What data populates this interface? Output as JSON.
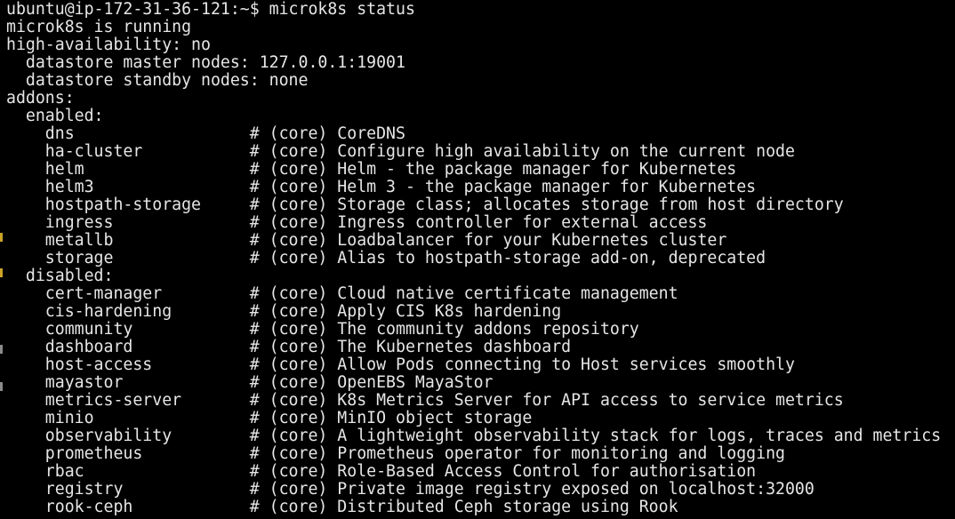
{
  "terminal": {
    "lines": [
      "ubuntu@ip-172-31-36-121:~$ microk8s status",
      "microk8s is running",
      "high-availability: no",
      "  datastore master nodes: 127.0.0.1:19001",
      "  datastore standby nodes: none",
      "addons:",
      "  enabled:",
      "    dns                  # (core) CoreDNS",
      "    ha-cluster           # (core) Configure high availability on the current node",
      "    helm                 # (core) Helm - the package manager for Kubernetes",
      "    helm3                # (core) Helm 3 - the package manager for Kubernetes",
      "    hostpath-storage     # (core) Storage class; allocates storage from host directory",
      "    ingress              # (core) Ingress controller for external access",
      "    metallb              # (core) Loadbalancer for your Kubernetes cluster",
      "    storage              # (core) Alias to hostpath-storage add-on, deprecated",
      "  disabled:",
      "    cert-manager         # (core) Cloud native certificate management",
      "    cis-hardening        # (core) Apply CIS K8s hardening",
      "    community            # (core) The community addons repository",
      "    dashboard            # (core) The Kubernetes dashboard",
      "    host-access          # (core) Allow Pods connecting to Host services smoothly",
      "    mayastor             # (core) OpenEBS MayaStor",
      "    metrics-server       # (core) K8s Metrics Server for API access to service metrics",
      "    minio                # (core) MinIO object storage",
      "    observability        # (core) A lightweight observability stack for logs, traces and metrics",
      "    prometheus           # (core) Prometheus operator for monitoring and logging",
      "    rbac                 # (core) Role-Based Access Control for authorisation",
      "    registry             # (core) Private image registry exposed on localhost:32000",
      "    rook-ceph            # (core) Distributed Ceph storage using Rook"
    ]
  },
  "colors": {
    "background": "#000000",
    "foreground": "#e6e6e6"
  }
}
